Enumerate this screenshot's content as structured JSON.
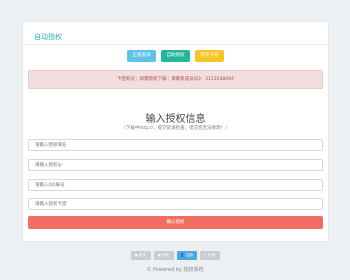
{
  "card": {
    "title": "自动授权"
  },
  "buttons": [
    {
      "label": "正版查询",
      "color": "#5ec1e8"
    },
    {
      "label": "自助授权",
      "color": "#25b59b"
    },
    {
      "label": "购买卡密",
      "color": "#f7c525"
    }
  ],
  "alert": {
    "text": "卡密购买：如需授权下载｜请联系成员QQ：3113548094"
  },
  "form": {
    "heading": "输入授权信息",
    "subheading": "（下载中http://，提交前请检查，提交后无法修改！）",
    "fields": [
      {
        "placeholder": "请输入授权域名"
      },
      {
        "placeholder": "请输入授权ip"
      },
      {
        "placeholder": "请输入QQ账号"
      },
      {
        "placeholder": "请输入授权卡密"
      }
    ],
    "submit_label": "确认授权"
  },
  "footer": {
    "buttons": [
      {
        "label": "◼ 首页",
        "color": "#c9ccd0"
      },
      {
        "label": "◼ 授权",
        "color": "#c9ccd0"
      },
      {
        "label": "👤 注册",
        "color": "#4ea7e0"
      },
      {
        "label": "✔ 检测",
        "color": "#c9ccd0"
      }
    ],
    "text": "© Powered by 授权系统"
  }
}
